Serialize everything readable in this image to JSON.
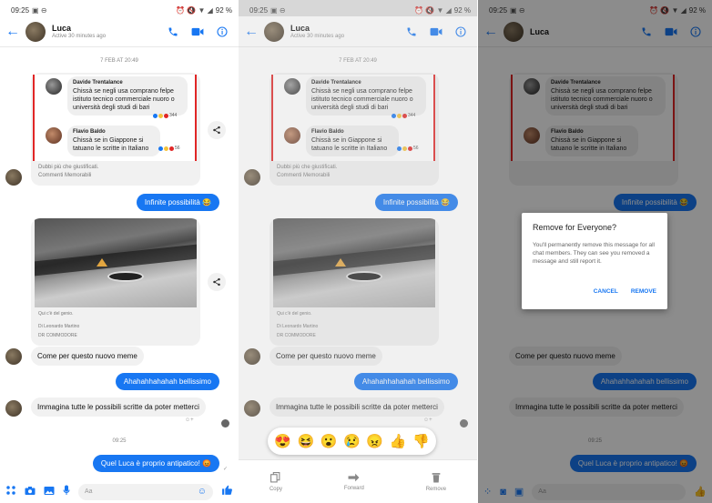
{
  "status": {
    "time": "09:25",
    "battery": "92 %"
  },
  "header": {
    "contact": "Luca",
    "subtitle": "Active 30 minutes ago"
  },
  "conversation": {
    "date_stamp": "7 FEB AT 20:49",
    "quoted_comments": [
      {
        "author": "Davide Trentalance",
        "text": "Chissà se negli usa comprano felpe istituto tecnico commerciale nuoro o università degli studi di bari",
        "count": "344"
      },
      {
        "author": "Flavio Baldo",
        "text": "Chissà se in Giappone si tatuano le scritte in Italiano",
        "count": "56"
      }
    ],
    "post1_caption": "Dubbi più che giustificati.",
    "post1_source": "Commenti Memorabili",
    "msg_infinite": "Infinite possibilità 😂",
    "post2_caption": "Qui c'è del genio.",
    "post2_author": "Di Leonardo Martino",
    "post2_source": "DR COMMODORE",
    "msg_come": "Come per questo nuovo meme",
    "msg_ahah": "Ahahahhahahah bellissimo",
    "msg_immagina": "Immagina tutte le possibili scritte da poter metterci",
    "time_stamp": "09:25",
    "msg_last": "Quel Luca è proprio antipatico! 😡",
    "composer_placeholder": "Aa"
  },
  "reaction_emojis": [
    "😍",
    "😆",
    "😮",
    "😢",
    "😠",
    "👍",
    "👎"
  ],
  "actions": {
    "copy": "Copy",
    "forward": "Forward",
    "remove": "Remove"
  },
  "dialog": {
    "title": "Remove for Everyone?",
    "body": "You'll permanently remove this message for all chat members. They can see you removed a message and still report it.",
    "cancel": "CANCEL",
    "remove": "REMOVE"
  },
  "colors": {
    "accent": "#1877f2",
    "quote_border": "#e02626"
  }
}
